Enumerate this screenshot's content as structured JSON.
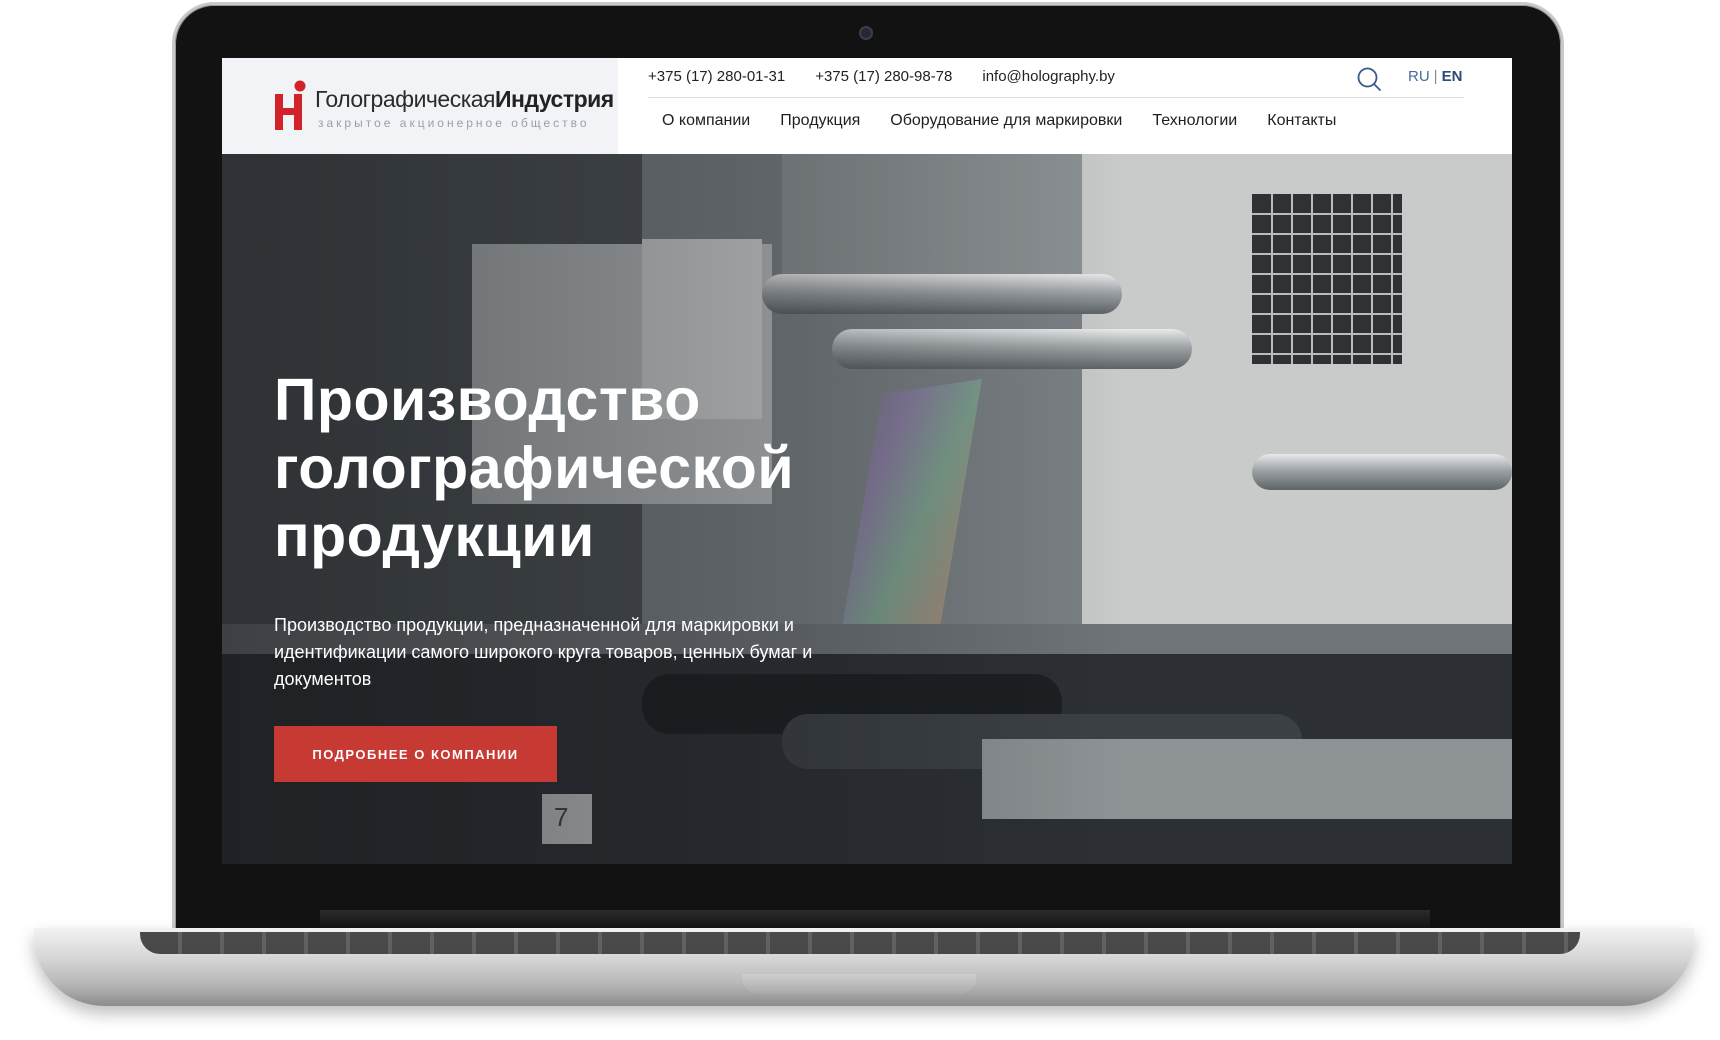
{
  "logo": {
    "main_regular": "Голографическая",
    "main_bold": "Индустрия",
    "sub": "закрытое акционерное общество"
  },
  "contacts": {
    "phone1": "+375 (17) 280-01-31",
    "phone2": "+375 (17) 280-98-78",
    "email": "info@holography.by"
  },
  "lang": {
    "ru": "RU",
    "separator": "|",
    "en": "EN",
    "active": "EN"
  },
  "nav": {
    "items": [
      {
        "label": "О компании"
      },
      {
        "label": "Продукция"
      },
      {
        "label": "Оборудование для маркировки"
      },
      {
        "label": "Технологии"
      },
      {
        "label": "Контакты"
      }
    ]
  },
  "hero": {
    "title": "Производство голографической продукции",
    "text": "Производство продукции, предназначенной для маркировки и идентификации самого широкого круга товаров, ценных бумаг и документов",
    "button_label": "ПОДРОБНЕЕ О КОМПАНИИ",
    "machine_number": "7"
  },
  "colors": {
    "accent": "#c63a33",
    "logo_red": "#d2232a",
    "link_blue": "#2c4a7a"
  },
  "icons": [
    "search-icon",
    "logo-mark-icon"
  ]
}
